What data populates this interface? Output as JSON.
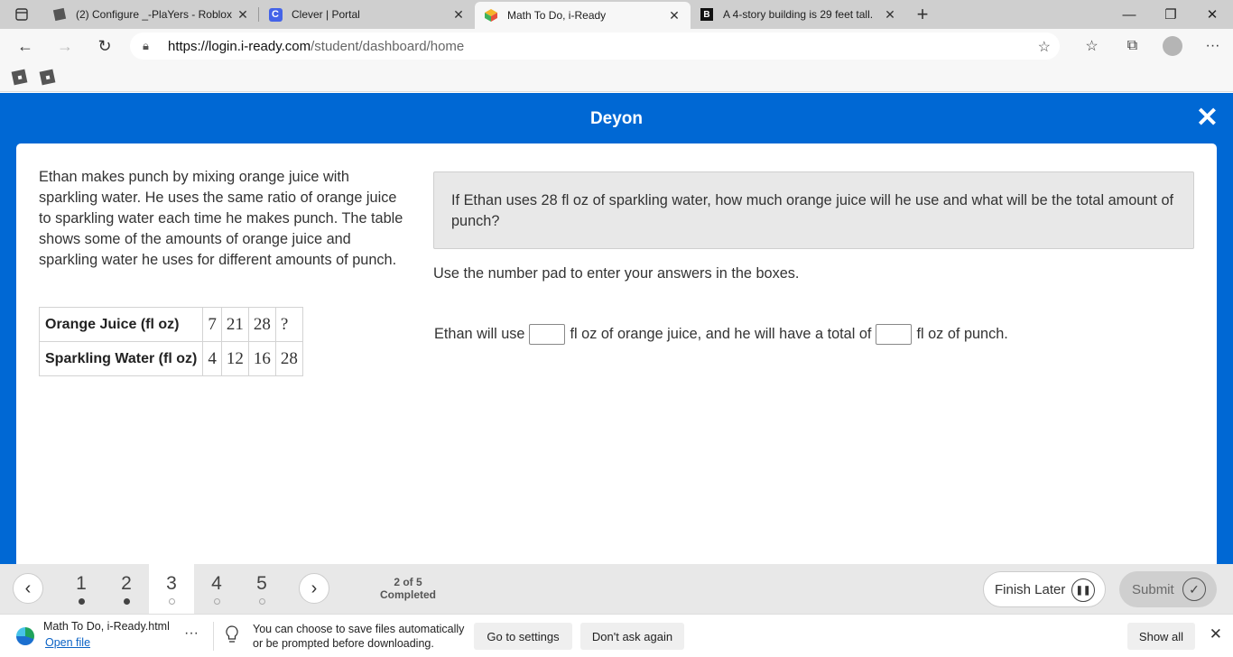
{
  "browser": {
    "tabs": [
      {
        "title": "(2) Configure _-PlaYers - Roblox",
        "icon": "roblox-icon",
        "active": false
      },
      {
        "title": "Clever | Portal",
        "icon": "clever-icon",
        "active": false
      },
      {
        "title": "Math To Do, i-Ready",
        "icon": "iready-icon",
        "active": true
      },
      {
        "title": "A 4-story building is 29 feet tall.",
        "icon": "brainly-icon",
        "active": false
      }
    ],
    "url_host": "https://login.i-ready.com",
    "url_path": "/student/dashboard/home"
  },
  "header": {
    "student_name": "Deyon"
  },
  "problem": {
    "text": "Ethan makes punch by mixing orange juice with sparkling water. He uses the same ratio of orange juice to sparkling water each time he makes punch. The table shows some of the amounts of orange juice and sparkling water he uses for different amounts of punch.",
    "table": {
      "rows": [
        {
          "label": "Orange Juice (fl oz)",
          "values": [
            "7",
            "21",
            "28",
            "?"
          ]
        },
        {
          "label": "Sparkling Water (fl oz)",
          "values": [
            "4",
            "12",
            "16",
            "28"
          ]
        }
      ]
    }
  },
  "question": {
    "prompt": "If Ethan uses 28 fl oz of sparkling water, how much orange juice will he use and what will be the total amount of punch?",
    "instruction": "Use the number pad to enter your answers in the boxes.",
    "answer_part1": "Ethan will use",
    "answer_part2": "fl oz of orange juice, and he will have a total of",
    "answer_part3": "fl oz of punch.",
    "answer1_value": "",
    "answer2_value": ""
  },
  "navigation": {
    "questions": [
      {
        "label": "1",
        "status": "done"
      },
      {
        "label": "2",
        "status": "done"
      },
      {
        "label": "3",
        "status": "current"
      },
      {
        "label": "4",
        "status": "todo"
      },
      {
        "label": "5",
        "status": "todo"
      }
    ],
    "progress_line1": "2 of 5",
    "progress_line2": "Completed",
    "finish_later": "Finish Later",
    "submit": "Submit"
  },
  "download_bar": {
    "file_name": "Math To Do, i-Ready.html",
    "open_file": "Open file",
    "message_line1": "You can choose to save files automatically",
    "message_line2": "or be prompted before downloading.",
    "go_to_settings": "Go to settings",
    "dont_ask_again": "Don't ask again",
    "show_all": "Show all"
  },
  "colors": {
    "brand_blue": "#0068d4",
    "nav_bg": "#e8e8e8"
  }
}
